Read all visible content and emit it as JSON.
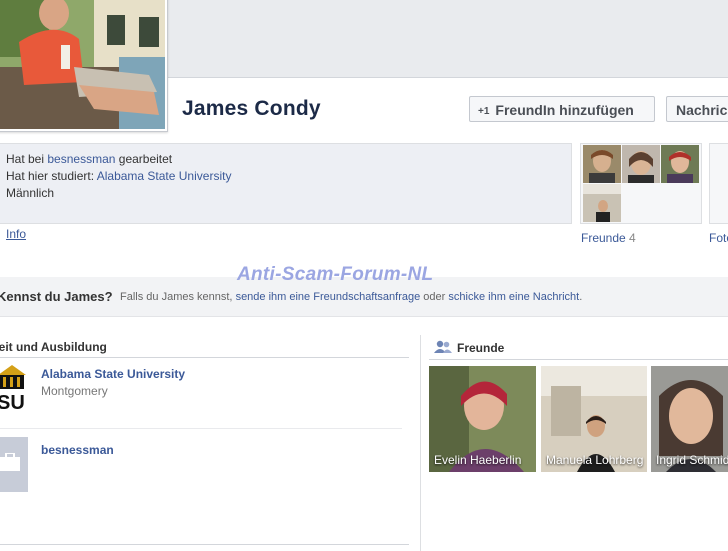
{
  "profile": {
    "name": "James Condy",
    "add_friend_label": "FreundIn hinzufügen",
    "message_label": "Nachricht",
    "add_icon": "+1"
  },
  "about": {
    "worked_prefix": "Hat bei",
    "worked_link": "besnessman",
    "worked_suffix": "gearbeitet",
    "studied_prefix": "Hat hier studiert:",
    "studied_link": "Alabama State University",
    "gender": "Männlich",
    "info_link": "Info"
  },
  "tabs": {
    "friends_label": "Freunde",
    "friends_count": "4",
    "photos_label": "Fotos"
  },
  "watermark": "Anti-Scam-Forum-NL",
  "know": {
    "title": "Kennst du James?",
    "t1": "Falls du James kennst,",
    "link1": "sende ihm eine Freundschaftsanfrage",
    "t2": "oder",
    "link2": "schicke ihm eine Nachricht",
    "t3": "."
  },
  "work_edu": {
    "heading": "Arbeit und Ausbildung",
    "items": [
      {
        "name": "Alabama State University",
        "sub": "Montgomery"
      },
      {
        "name": "besnessman",
        "sub": ""
      }
    ]
  },
  "friends": {
    "heading": "Freunde",
    "list": [
      {
        "name": "Evelin Haeberlin"
      },
      {
        "name": "Manuela Lohrberg"
      },
      {
        "name": "Ingrid Schmidt"
      }
    ]
  },
  "colors": {
    "link": "#3b5998",
    "name": "#1c2a47",
    "watermark": "#9ba6e2"
  }
}
